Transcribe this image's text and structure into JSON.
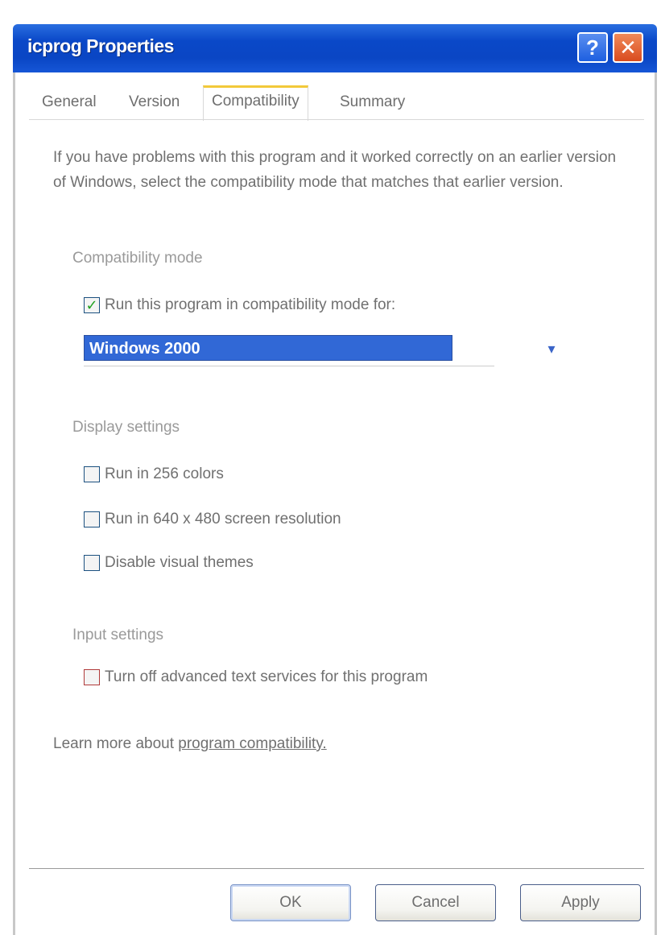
{
  "window": {
    "title": "icprog Properties",
    "help_glyph": "?",
    "close_glyph": "✕"
  },
  "tabs": [
    {
      "label": "General"
    },
    {
      "label": "Version"
    },
    {
      "label": "Compatibility",
      "active": true
    },
    {
      "label": "Summary"
    }
  ],
  "description": "If you have problems with this program and it worked correctly on an earlier version of Windows, select the compatibility mode that matches that earlier version.",
  "compatibility_mode": {
    "group_label": "Compatibility mode",
    "checkbox_label": "Run this program in compatibility mode for:",
    "checked": true,
    "selected_os": "Windows 2000"
  },
  "display_settings": {
    "group_label": "Display settings",
    "options": [
      {
        "label": "Run in 256 colors",
        "checked": false
      },
      {
        "label": "Run in 640 x 480 screen resolution",
        "checked": false
      },
      {
        "label": "Disable visual themes",
        "checked": false
      }
    ]
  },
  "input_settings": {
    "group_label": "Input settings",
    "options": [
      {
        "label": "Turn off advanced text services for this program",
        "checked": false
      }
    ]
  },
  "learn_more": {
    "prefix": "Learn more about ",
    "link": "program compatibility."
  },
  "buttons": {
    "ok": "OK",
    "cancel": "Cancel",
    "apply": "Apply"
  },
  "colors": {
    "titlebar": "#0a48c8",
    "selection": "#3168d6",
    "active_tab_accent": "#f2c93a",
    "check_mark": "#21a121"
  }
}
